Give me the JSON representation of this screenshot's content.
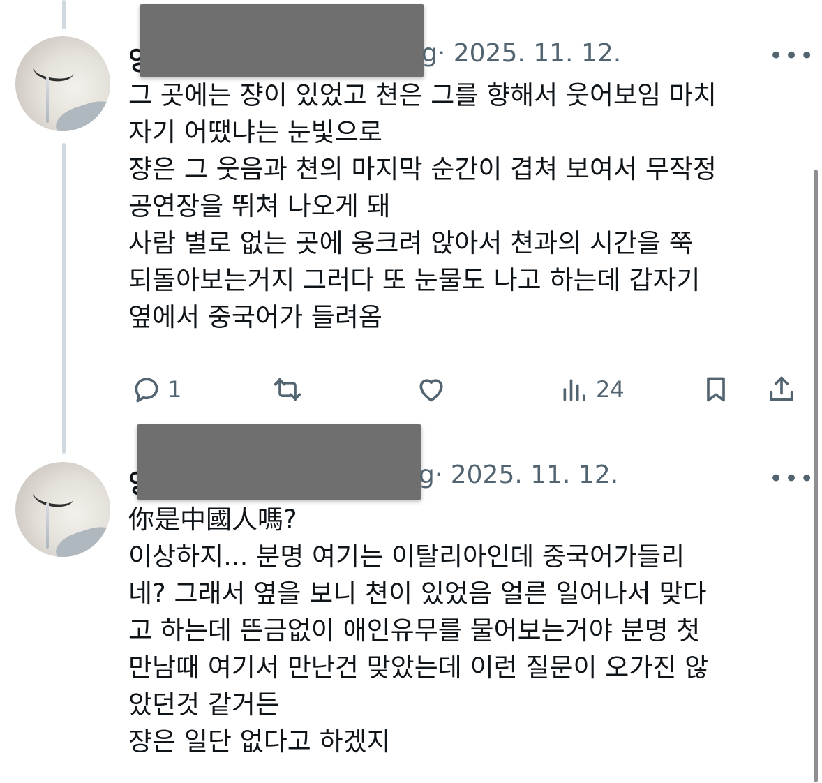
{
  "posts": [
    {
      "name_visible_prefix": "양",
      "handle_visible_suffix": "g",
      "date": "· 2025. 11. 12.",
      "more_label": "•••",
      "lines": [
        "그 곳에는 쟝이 있었고 쳔은 그를 향해서 웃어보임 마치",
        "자기 어땠냐는 눈빛으로",
        "쟝은 그 웃음과 쳔의 마지막 순간이 겹쳐 보여서 무작정",
        "공연장을 뛰쳐 나오게 돼",
        "사람 별로 없는 곳에 웅크려 앉아서 쳔과의 시간을 쭉",
        "되돌아보는거지 그러다 또 눈물도 나고 하는데 갑자기",
        "옆에서 중국어가 들려옴"
      ],
      "actions": {
        "reply_icon": "reply-icon",
        "reply_count": "1",
        "retweet_icon": "retweet-icon",
        "like_icon": "heart-icon",
        "views_icon": "views-icon",
        "views_count": "24",
        "bookmark_icon": "bookmark-icon",
        "share_icon": "share-icon"
      }
    },
    {
      "name_visible_prefix": "양",
      "handle_visible_suffix": "g",
      "date": "· 2025. 11. 12.",
      "more_label": "•••",
      "lines": [
        "你是中國人嗎?",
        "이상하지... 분명 여기는 이탈리아인데 중국어가들리",
        "네? 그래서 옆을 보니 쳔이 있었음 얼른 일어나서 맞다",
        "고 하는데 뜬금없이 애인유무를 물어보는거야 분명 첫",
        "만남때 여기서 만난건 맞았는데 이런 질문이 오가진 않",
        "았던것 같거든",
        "쟝은 일단 없다고 하겠지"
      ]
    }
  ],
  "colors": {
    "text": "#0f1419",
    "secondary": "#536471",
    "thread_line": "#cfd9de",
    "redaction": "#6f6f70"
  }
}
